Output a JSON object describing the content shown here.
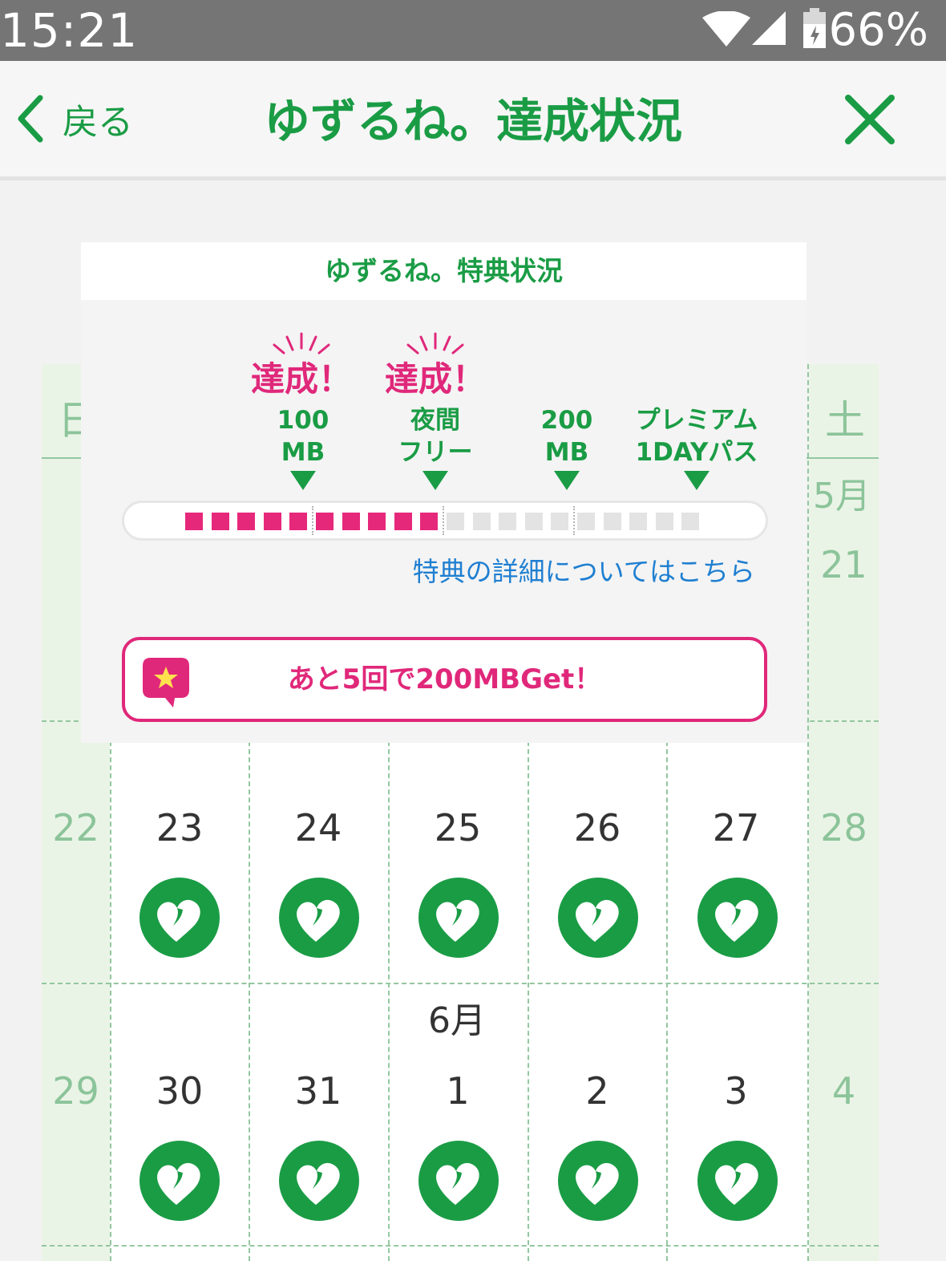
{
  "statusbar": {
    "time": "15:21",
    "battery": "66%"
  },
  "nav": {
    "back_label": "戻る",
    "title": "ゆずるね。達成状況"
  },
  "calendar": {
    "dow_sun": "日",
    "dow_sat": "土",
    "month_may": "5月",
    "month_june": "6月",
    "week_pre": {
      "sat": "21"
    },
    "week1": {
      "sun": "22",
      "days": [
        "23",
        "24",
        "25",
        "26",
        "27"
      ],
      "sat": "28"
    },
    "week2": {
      "sun": "29",
      "days": [
        "30",
        "31",
        "1",
        "2",
        "3"
      ],
      "sat": "4"
    }
  },
  "benefit": {
    "header": "ゆずるね。特典状況",
    "achieved_label": "達成！",
    "milestones": [
      {
        "line1": "100",
        "line2": "MB",
        "achieved": true
      },
      {
        "line1": "夜間",
        "line2": "フリー",
        "achieved": true
      },
      {
        "line1": "200",
        "line2": "MB",
        "achieved": false
      },
      {
        "line1": "プレミアム",
        "line2": "1DAYパス",
        "achieved": false
      }
    ],
    "progress": {
      "filled": 10,
      "total": 20
    },
    "details_link": "特典の詳細についてはこちら",
    "next_message": "あと5回で200MBGet！"
  },
  "colors": {
    "brand_green": "#1a9c45",
    "accent_pink": "#e0287a",
    "link_blue": "#1f7fd1"
  },
  "icons": {
    "back": "chevron-left-icon",
    "close": "close-icon",
    "stamp": "heart-stamp-icon",
    "bubble": "star-bubble-icon"
  }
}
